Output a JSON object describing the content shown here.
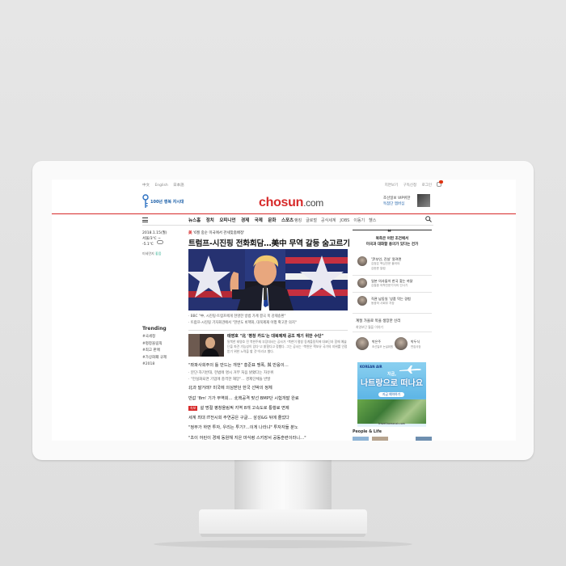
{
  "top_links_left": [
    "中文",
    "English",
    "日本語"
  ],
  "top_links_right": [
    "지면보기",
    "구독신청",
    "로그인"
  ],
  "bell_badge": "2",
  "left_logo_text": "100년 행복 자시대",
  "brand": {
    "name": "chosun",
    "tld": ".com"
  },
  "promo": {
    "line1": "조선일보 VIP위한",
    "line2": "독점단 멤버십"
  },
  "nav": [
    "뉴스홈",
    "정치",
    "오피니언",
    "경제",
    "국제",
    "문화",
    "스포츠"
  ],
  "nav_secondary": [
    "랭킹",
    "글로벌",
    "공식세계",
    "JOBS",
    "이동기",
    "헬스"
  ],
  "date": {
    "line1": "2018.1.15(월)",
    "line2": "서울/3℃ ~",
    "line3": "-5.1℃"
  },
  "dust": {
    "label": "미세먼지",
    "value": "좋음"
  },
  "trending": {
    "title": "Trending",
    "items": [
      "#국세청",
      "#평창올림픽",
      "#최고 판매",
      "#가상화폐 규제",
      "#2018"
    ]
  },
  "kicker": {
    "tag": "美",
    "text": "'6월 중순 미국에서 관세맞춤배정'"
  },
  "headline": "트럼프-시진핑 전화회담…美中 무역 갈등 숨고르기",
  "captions": [
    "· BBC \"中, 시진핑·트럼프에게 현명한 방법 가계 결국 복 강제송환\"",
    "· 트럼프-시진핑 기자회견에서 \"한반도 비핵화, 대북제재 이행 확고한 의지\""
  ],
  "opinion": {
    "title": "태영호 \"北 '평창 카드'는 대북제재 공조 깨기 위한 수단\"",
    "body": "탈북한 태영호 전 북한주재 부장대사는 공사가 \"북한이 평창 동계올림픽에 대표단과 함께 예술단을 파견 가능성이 있다\"고 밝혔다고 정했다. 그는 공사는 \"북한은 핵보유 국가의 지위를 인정받기 위한 노력을 할 것\"이라고 했다."
  },
  "stories": [
    {
      "text": "\"좌파사회주의 틀 만드는 개헌\" 홍준표 맹폭, 與 반응이…",
      "sub": false,
      "tag": ""
    },
    {
      "text": "· 분단·자기반대, 헌법에 명시 거부 처음 밝혔다는 자유위",
      "sub": true,
      "tag": ""
    },
    {
      "text": "· \"헌실화되면 기업에 충격한 재앙\"… 경제단체들 반발",
      "sub": true,
      "tag": ""
    },
    {
      "text": "北과 말거래? 미국에 의심받던 한국 선박의 정체",
      "sub": false,
      "tag": ""
    },
    {
      "text": "반값 '8m' 기가 무역회… 北핵공격 맞선 BMP단 시험개발 완료",
      "sub": false,
      "tag": ""
    },
    {
      "text": "설 명절 평창올림픽 지역 8개 고속도로 통행료 면제",
      "sub": false,
      "tag": "속보"
    },
    {
      "text": "세계 최대 IT전시회 주연공은 구글… 삼성&G 뒤에 줄었다",
      "sub": false,
      "tag": ""
    },
    {
      "text": "\"정부가 하면 투자, 우리는 투기?…이게 나라냐\" 투자자들 분노",
      "sub": false,
      "tag": ""
    },
    {
      "text": "\"초이 어린이 경제 동원해 지은 마식령 스키장서 공동훈련이라니…\"",
      "sub": false,
      "tag": ""
    }
  ],
  "right_box": {
    "head1": "북측은 어떤 조건에서",
    "head2": "미국과 대화할 용의가 있다는 건가",
    "columns": [
      {
        "title": "'尹부인, 진실' 알려면",
        "name": "김범준 칼럼 / 보수 1981",
        "title2": "김정은 핵심전문 볼러야",
        "name2": "김현준 칼럼"
      },
      {
        "title": "일본 의사들이 한국 찾는 까닭",
        "name": "김철중 의학전문기자의 인사기"
      },
      {
        "title": "직관 남동일 '상품 막는 경험",
        "name": "동광하 사회부 차장"
      }
    ],
    "line": "계절 가을로 목을 생장한 신리",
    "line_sub": "최영보단 월을 이야기"
  },
  "people_small": [
    {
      "name": "박은주",
      "role": "조선일보 논설위원"
    },
    {
      "name": "박두식",
      "role": "편집국장"
    }
  ],
  "ad": {
    "brand": "KOREAN AIR",
    "line1": "지금,",
    "line2": "나트랑으로 떠나요",
    "button": "지금 예약하기",
    "url": "travel.koreanair.com"
  },
  "people_life": "People & Life",
  "colors": {
    "brand_red": "#d72a2a",
    "nav_blue": "#1b5fa8"
  }
}
